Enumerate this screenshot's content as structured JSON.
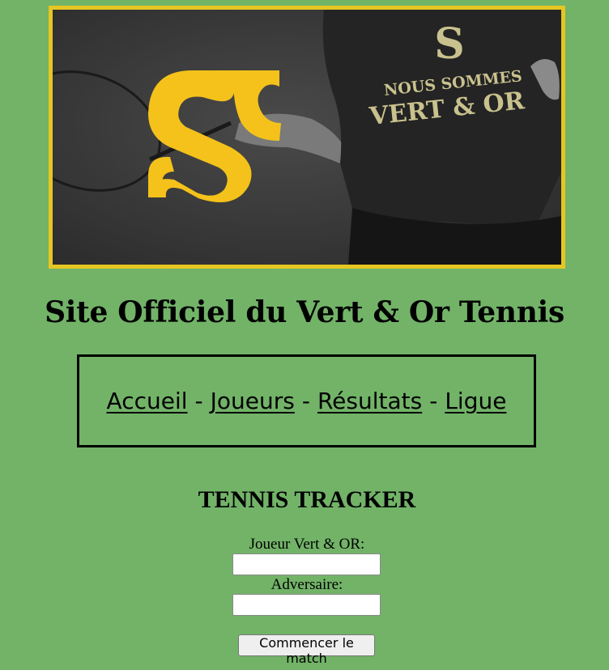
{
  "banner": {
    "shirt_line1": "NOUS SOMMES",
    "shirt_line2": "VERT & OR",
    "logo_letter": "S",
    "border_color": "#e6c623",
    "logo_color": "#f4c21a"
  },
  "site_title": "Site Officiel du Vert & Or Tennis",
  "nav": {
    "items": [
      {
        "label": "Accueil"
      },
      {
        "label": "Joueurs"
      },
      {
        "label": "Résultats"
      },
      {
        "label": "Ligue"
      }
    ],
    "separator": "-"
  },
  "tracker": {
    "title": "TENNIS TRACKER",
    "player_label": "Joueur Vert & OR:",
    "player_value": "",
    "opponent_label": "Adversaire:",
    "opponent_value": "",
    "start_button": "Commencer le match"
  },
  "colors": {
    "page_background": "#72b368"
  }
}
